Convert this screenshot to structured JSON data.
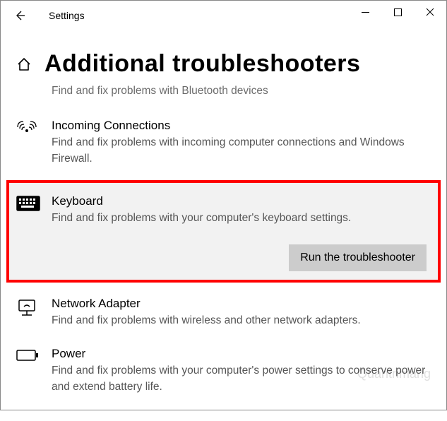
{
  "window": {
    "title": "Settings"
  },
  "header": {
    "title": "Additional troubleshooters"
  },
  "cutoff_top": "Find and fix problems with Bluetooth devices",
  "items": [
    {
      "title": "Incoming Connections",
      "desc": "Find and fix problems with incoming computer connections and Windows Firewall."
    },
    {
      "title": "Keyboard",
      "desc": "Find and fix problems with your computer's keyboard settings.",
      "action": "Run the troubleshooter"
    },
    {
      "title": "Network Adapter",
      "desc": "Find and fix problems with wireless and other network adapters."
    },
    {
      "title": "Power",
      "desc": "Find and fix problems with your computer's power settings to conserve power and extend battery life."
    }
  ],
  "watermark": "Quantrimang"
}
